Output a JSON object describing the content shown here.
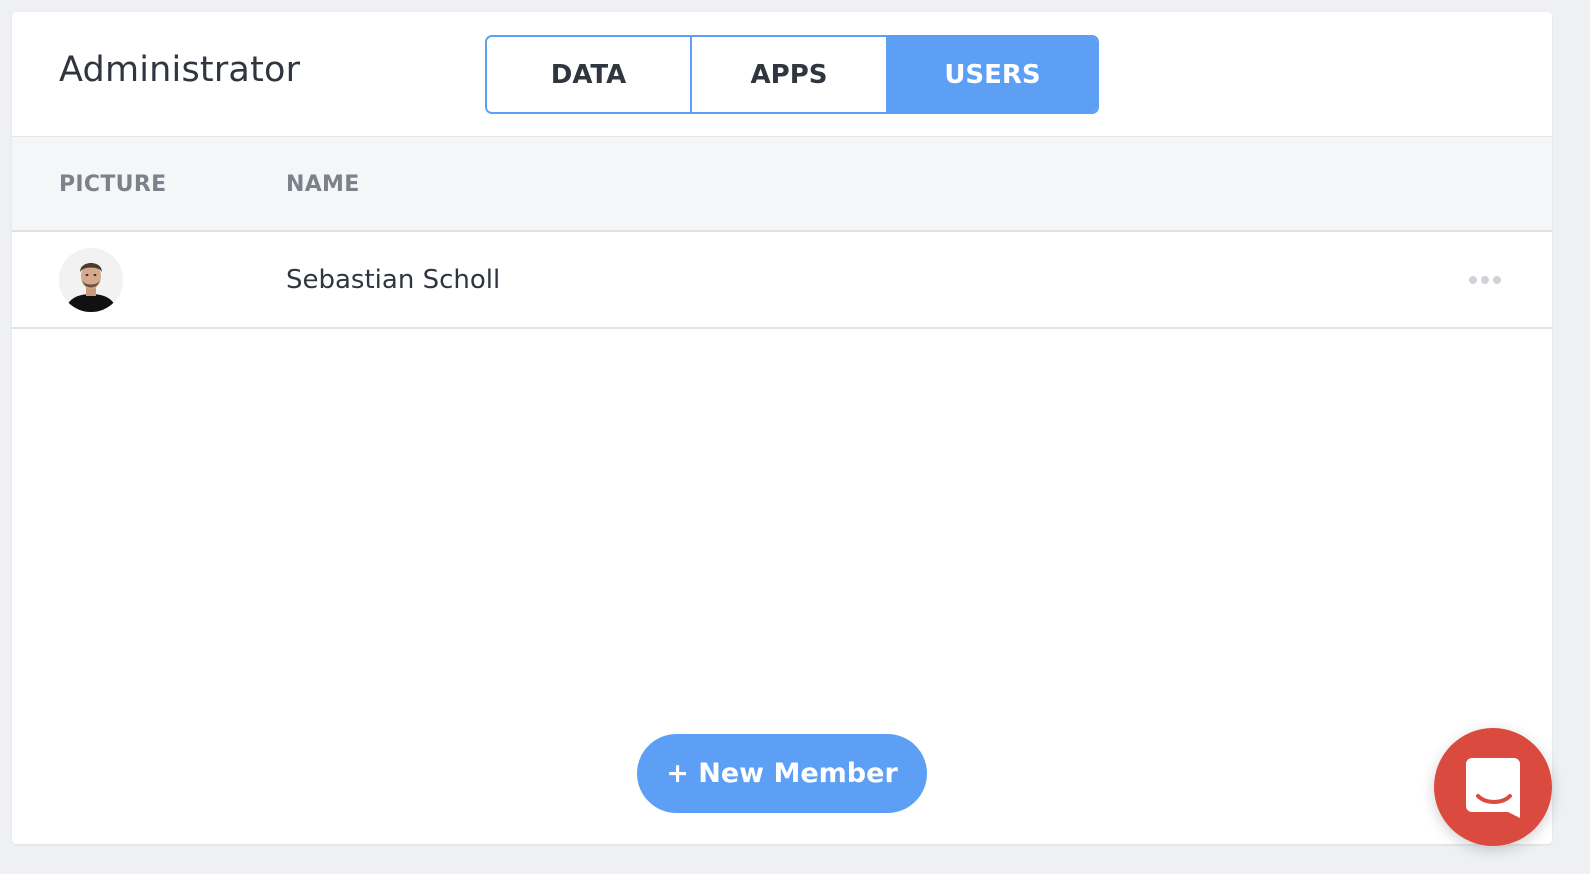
{
  "header": {
    "title": "Administrator",
    "tabs": [
      {
        "label": "DATA",
        "active": false
      },
      {
        "label": "APPS",
        "active": false
      },
      {
        "label": "USERS",
        "active": true
      }
    ]
  },
  "table": {
    "columns": [
      "PICTURE",
      "NAME"
    ],
    "rows": [
      {
        "picture": "user-avatar-icon",
        "name": "Sebastian Scholl",
        "actions_icon": "more-horizontal-icon"
      }
    ]
  },
  "actions": {
    "new_member_label": "+ New Member"
  },
  "chat_launcher": {
    "icon": "chat-bubble-icon"
  },
  "colors": {
    "accent": "#5c9ff5",
    "chat": "#db4a3f",
    "text": "#2f3640",
    "muted": "#7c828b"
  }
}
